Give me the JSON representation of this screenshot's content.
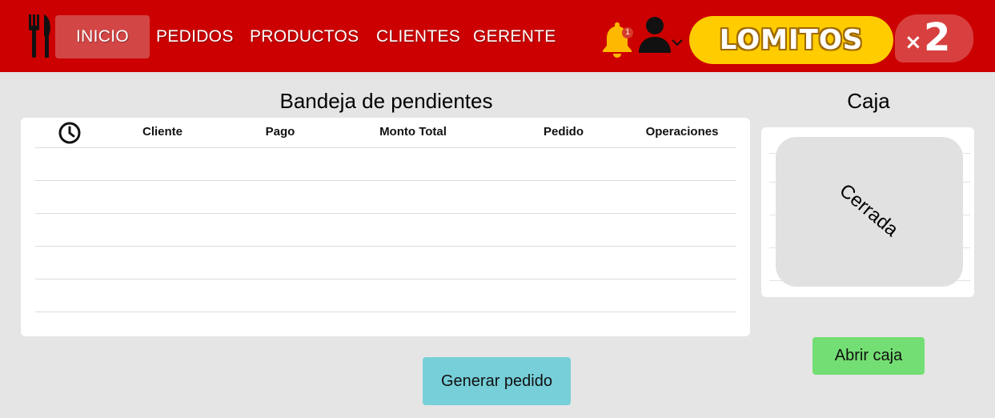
{
  "nav": {
    "items": [
      {
        "label": "INICIO",
        "active": true
      },
      {
        "label": "PEDIDOS",
        "active": false
      },
      {
        "label": "PRODUCTOS",
        "active": false
      },
      {
        "label": "CLIENTES",
        "active": false
      },
      {
        "label": "GERENTE",
        "active": false
      }
    ],
    "notifications_count": "1",
    "brand_name": "LOMITOS",
    "brand_badge_symbol": "×",
    "brand_badge_number": "2",
    "logo_icon": "fork-knife-icon",
    "colors": {
      "navbar": "#cc0000",
      "brand_pill": "#ffcc00",
      "brand_badge": "#d84040"
    }
  },
  "pending": {
    "title": "Bandeja de pendientes",
    "columns": [
      "Cliente",
      "Pago",
      "Monto Total",
      "Pedido",
      "Operaciones"
    ],
    "time_column_icon": "clock-icon",
    "rows": []
  },
  "caja": {
    "title": "Caja",
    "status": "Cerrada",
    "open_button": "Abrir caja"
  },
  "actions": {
    "generate_order": "Generar pedido",
    "colors": {
      "generate": "#76cfd9",
      "open_cash": "#73de73"
    }
  }
}
